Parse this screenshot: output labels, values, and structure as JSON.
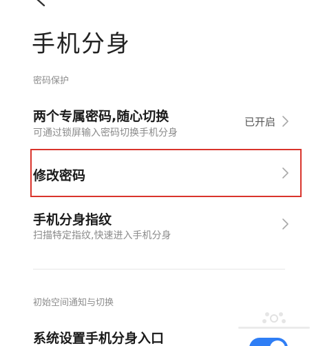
{
  "header": {
    "back_icon": "back-arrow-icon",
    "title": "手机分身"
  },
  "sections": {
    "password_protection": {
      "label": "密码保护",
      "items": [
        {
          "title": "两个专属密码,随心切换",
          "subtitle": "可通过锁屏输入密码切换手机分身",
          "value": "已开启",
          "icon": "chevron-right-icon"
        },
        {
          "title": "修改密码",
          "icon": "chevron-right-icon"
        },
        {
          "title": "手机分身指纹",
          "subtitle": "扫描特定指纹,快速进入手机分身",
          "icon": "chevron-right-icon"
        }
      ]
    },
    "initial_space": {
      "label": "初始空间通知与切换",
      "items": [
        {
          "title": "系统设置手机分身入口",
          "toggle_on": true
        }
      ]
    }
  },
  "colors": {
    "highlight": "#d9332b",
    "toggle_on": "#2f7ef5"
  }
}
